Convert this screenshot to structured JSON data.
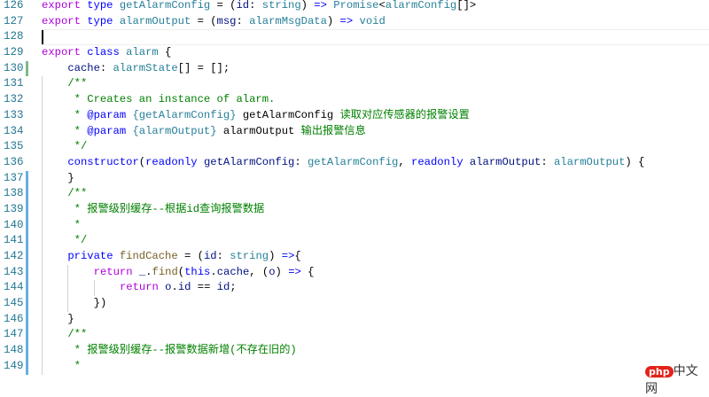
{
  "editor": {
    "lines": [
      {
        "n": "126",
        "indent": 0,
        "tokens": [
          [
            "k",
            "export"
          ],
          [
            "p",
            " "
          ],
          [
            "b",
            "type"
          ],
          [
            "p",
            " "
          ],
          [
            "t",
            "getAlarmConfig"
          ],
          [
            "p",
            " = ("
          ],
          [
            "v",
            "id"
          ],
          [
            "p",
            ": "
          ],
          [
            "t",
            "string"
          ],
          [
            "p",
            ") "
          ],
          [
            "d",
            "=>"
          ],
          [
            "p",
            " "
          ],
          [
            "t",
            "Promise"
          ],
          [
            "p",
            "<"
          ],
          [
            "t",
            "alarmConfig"
          ],
          [
            "p",
            "[]>"
          ]
        ]
      },
      {
        "n": "127",
        "indent": 0,
        "tokens": [
          [
            "k",
            "export"
          ],
          [
            "p",
            " "
          ],
          [
            "b",
            "type"
          ],
          [
            "p",
            " "
          ],
          [
            "t",
            "alarmOutput"
          ],
          [
            "p",
            " = ("
          ],
          [
            "v",
            "msg"
          ],
          [
            "p",
            ": "
          ],
          [
            "t",
            "alarmMsgData"
          ],
          [
            "p",
            ") "
          ],
          [
            "d",
            "=>"
          ],
          [
            "p",
            " "
          ],
          [
            "t",
            "void"
          ]
        ]
      },
      {
        "n": "128",
        "indent": 0,
        "cursor": true,
        "tokens": []
      },
      {
        "n": "129",
        "indent": 0,
        "tokens": [
          [
            "k",
            "export"
          ],
          [
            "p",
            " "
          ],
          [
            "b",
            "class"
          ],
          [
            "p",
            " "
          ],
          [
            "t",
            "alarm"
          ],
          [
            "p",
            " {"
          ]
        ]
      },
      {
        "n": "130",
        "indent": 1,
        "mark": "add",
        "tokens": [
          [
            "v",
            "cache"
          ],
          [
            "p",
            ": "
          ],
          [
            "t",
            "alarmState"
          ],
          [
            "p",
            "[] = [];"
          ]
        ]
      },
      {
        "n": "131",
        "indent": 1,
        "tokens": [
          [
            "c",
            "/**"
          ]
        ]
      },
      {
        "n": "132",
        "indent": 1,
        "tokens": [
          [
            "c",
            " * Creates an instance of alarm."
          ]
        ]
      },
      {
        "n": "133",
        "indent": 1,
        "tokens": [
          [
            "c",
            " * "
          ],
          [
            "b",
            "@param"
          ],
          [
            "c",
            " "
          ],
          [
            "t",
            "{getAlarmConfig}"
          ],
          [
            "c",
            " "
          ],
          [
            "p",
            "getAlarmConfig"
          ],
          [
            "c",
            " 读取对应传感器的报警设置"
          ]
        ]
      },
      {
        "n": "134",
        "indent": 1,
        "tokens": [
          [
            "c",
            " * "
          ],
          [
            "b",
            "@param"
          ],
          [
            "c",
            " "
          ],
          [
            "t",
            "{alarmOutput}"
          ],
          [
            "c",
            " "
          ],
          [
            "p",
            "alarmOutput"
          ],
          [
            "c",
            " 输出报警信息"
          ]
        ]
      },
      {
        "n": "135",
        "indent": 1,
        "tokens": [
          [
            "c",
            " */"
          ]
        ]
      },
      {
        "n": "136",
        "indent": 1,
        "tokens": [
          [
            "b",
            "constructor"
          ],
          [
            "p",
            "("
          ],
          [
            "b",
            "readonly"
          ],
          [
            "p",
            " "
          ],
          [
            "v",
            "getAlarmConfig"
          ],
          [
            "p",
            ": "
          ],
          [
            "t",
            "getAlarmConfig"
          ],
          [
            "p",
            ", "
          ],
          [
            "b",
            "readonly"
          ],
          [
            "p",
            " "
          ],
          [
            "v",
            "alarmOutput"
          ],
          [
            "p",
            ": "
          ],
          [
            "t",
            "alarmOutput"
          ],
          [
            "p",
            ") {"
          ]
        ]
      },
      {
        "n": "137",
        "indent": 1,
        "mark": "mod",
        "tokens": [
          [
            "p",
            "}"
          ]
        ]
      },
      {
        "n": "138",
        "indent": 1,
        "mark": "mod",
        "tokens": [
          [
            "c",
            "/**"
          ]
        ]
      },
      {
        "n": "139",
        "indent": 1,
        "mark": "mod",
        "tokens": [
          [
            "c",
            " * 报警级别缓存--根据id查询报警数据"
          ]
        ]
      },
      {
        "n": "140",
        "indent": 1,
        "mark": "mod",
        "tokens": [
          [
            "c",
            " *"
          ]
        ]
      },
      {
        "n": "141",
        "indent": 1,
        "mark": "mod",
        "tokens": [
          [
            "c",
            " */"
          ]
        ]
      },
      {
        "n": "142",
        "indent": 1,
        "mark": "mod",
        "tokens": [
          [
            "b",
            "private"
          ],
          [
            "p",
            " "
          ],
          [
            "f",
            "findCache"
          ],
          [
            "p",
            " = ("
          ],
          [
            "v",
            "id"
          ],
          [
            "p",
            ": "
          ],
          [
            "t",
            "string"
          ],
          [
            "p",
            ") "
          ],
          [
            "d",
            "=>"
          ],
          [
            "p",
            "{"
          ]
        ]
      },
      {
        "n": "143",
        "indent": 2,
        "mark": "mod",
        "tokens": [
          [
            "k",
            "return"
          ],
          [
            "p",
            " "
          ],
          [
            "v",
            "_"
          ],
          [
            "p",
            "."
          ],
          [
            "f",
            "find"
          ],
          [
            "p",
            "("
          ],
          [
            "b",
            "this"
          ],
          [
            "p",
            "."
          ],
          [
            "v",
            "cache"
          ],
          [
            "p",
            ", ("
          ],
          [
            "v",
            "o"
          ],
          [
            "p",
            ") "
          ],
          [
            "d",
            "=>"
          ],
          [
            "p",
            " {"
          ]
        ]
      },
      {
        "n": "144",
        "indent": 3,
        "mark": "mod",
        "tokens": [
          [
            "k",
            "return"
          ],
          [
            "p",
            " "
          ],
          [
            "v",
            "o"
          ],
          [
            "p",
            "."
          ],
          [
            "v",
            "id"
          ],
          [
            "p",
            " == "
          ],
          [
            "v",
            "id"
          ],
          [
            "p",
            ";"
          ]
        ]
      },
      {
        "n": "145",
        "indent": 2,
        "mark": "mod",
        "tokens": [
          [
            "p",
            "})"
          ]
        ]
      },
      {
        "n": "146",
        "indent": 1,
        "mark": "mod",
        "tokens": [
          [
            "p",
            "}"
          ]
        ]
      },
      {
        "n": "147",
        "indent": 1,
        "mark": "mod",
        "tokens": [
          [
            "c",
            "/**"
          ]
        ]
      },
      {
        "n": "148",
        "indent": 1,
        "mark": "mod",
        "tokens": [
          [
            "c",
            " * 报警级别缓存--报警数据新增(不存在旧的)"
          ]
        ]
      },
      {
        "n": "149",
        "indent": 1,
        "mark": "mod",
        "tokens": [
          [
            "c",
            " *"
          ]
        ]
      }
    ]
  },
  "watermark": {
    "logo": "php",
    "text": "中文网"
  }
}
